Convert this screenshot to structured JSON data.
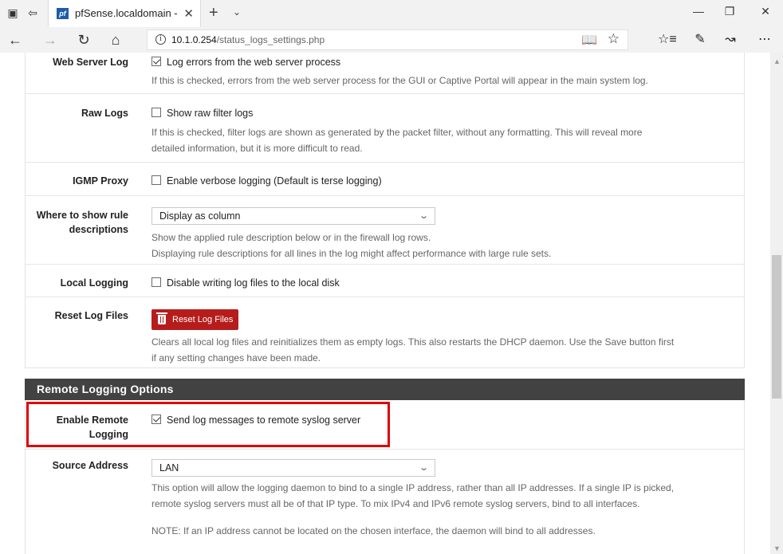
{
  "browser": {
    "tab_title": "pfSense.localdomain - S",
    "favicon_text": "pf",
    "url_host": "10.1.0.254",
    "url_path": "/status_logs_settings.php"
  },
  "icons": {
    "tab_actions": "tab-set-aside-icon",
    "close_tab": "close-icon",
    "new_tab": "plus-icon",
    "back": "back-arrow-icon",
    "forward": "forward-arrow-icon",
    "refresh": "refresh-icon",
    "home": "home-icon",
    "reading_view": "reading-view-icon",
    "favorite": "star-icon",
    "favorites_hub": "favorites-list-icon",
    "notes": "pen-icon",
    "share": "share-icon",
    "more": "more-icon"
  },
  "settings": {
    "web_server_log": {
      "label": "Web Server Log",
      "checkbox_label": "Log errors from the web server process",
      "checked": true,
      "help": "If this is checked, errors from the web server process for the GUI or Captive Portal will appear in the main system log."
    },
    "raw_logs": {
      "label": "Raw Logs",
      "checkbox_label": "Show raw filter logs",
      "checked": false,
      "help_line1": "If this is checked, filter logs are shown as generated by the packet filter, without any formatting. This will reveal more",
      "help_line2": "detailed information, but it is more difficult to read."
    },
    "igmp_proxy": {
      "label": "IGMP Proxy",
      "checkbox_label": "Enable verbose logging (Default is terse logging)",
      "checked": false
    },
    "rule_descriptions": {
      "label_line1": "Where to show rule",
      "label_line2": "descriptions",
      "selected": "Display as column",
      "help_line1": "Show the applied rule description below or in the firewall log rows.",
      "help_line2": "Displaying rule descriptions for all lines in the log might affect performance with large rule sets."
    },
    "local_logging": {
      "label": "Local Logging",
      "checkbox_label": "Disable writing log files to the local disk",
      "checked": false
    },
    "reset_log_files": {
      "label": "Reset Log Files",
      "button_label": "Reset Log Files",
      "help_line1": "Clears all local log files and reinitializes them as empty logs. This also restarts the DHCP daemon. Use the Save button first",
      "help_line2": "if any setting changes have been made."
    }
  },
  "remote": {
    "section_title": "Remote Logging Options",
    "enable": {
      "label_line1": "Enable Remote",
      "label_line2": "Logging",
      "checkbox_label": "Send log messages to remote syslog server",
      "checked": true
    },
    "source_address": {
      "label": "Source Address",
      "selected": "LAN",
      "help_line1": "This option will allow the logging daemon to bind to a single IP address, rather than all IP addresses. If a single IP is picked,",
      "help_line2": "remote syslog servers must all be of that IP type. To mix IPv4 and IPv6 remote syslog servers, bind to all interfaces.",
      "note": "NOTE: If an IP address cannot be located on the chosen interface, the daemon will bind to all addresses."
    }
  },
  "colors": {
    "section_header_bg": "#424242",
    "danger_button": "#b71c1c",
    "highlight_box": "#e00000"
  }
}
